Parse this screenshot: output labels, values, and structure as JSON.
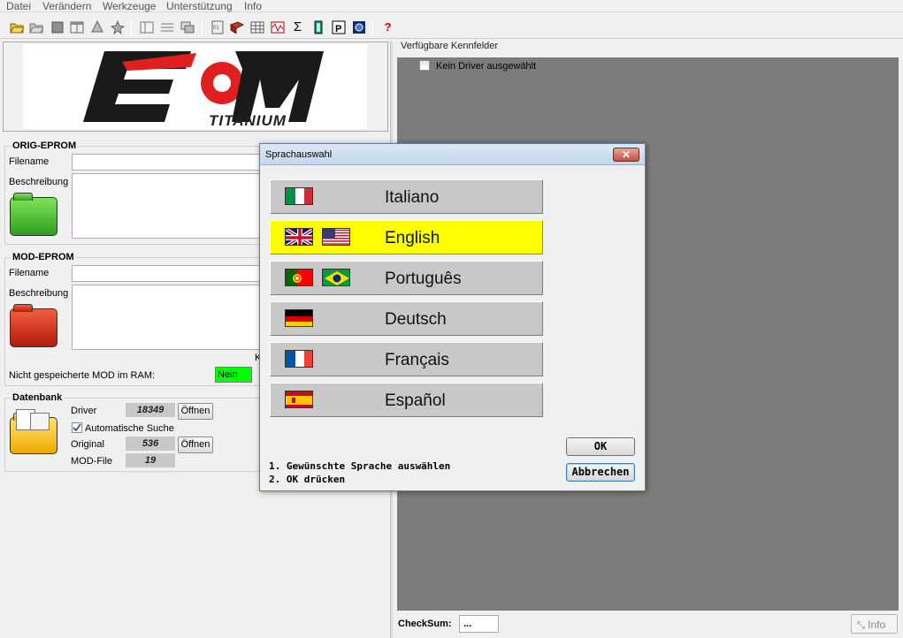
{
  "menu": [
    "Datei",
    "Verändern",
    "Werkzeuge",
    "Unterstützung",
    "Info"
  ],
  "toolbar_icons": [
    "open-folder-icon",
    "open-folder-2-icon",
    "save-icon",
    "window-icon",
    "tree-icon",
    "star-icon",
    "panel-icon",
    "grid-icon",
    "windows-icon",
    "binary-icon",
    "book-icon",
    "table-icon",
    "noise-icon",
    "sigma-icon",
    "battery-icon",
    "p-icon",
    "globe-icon",
    "help-icon"
  ],
  "logo": {
    "text_main": "ECM",
    "text_sub": "TITANIUM"
  },
  "orig": {
    "title": "ORIG-EPROM",
    "filename_label": "Filename",
    "desc_label": "Beschreibung"
  },
  "mod": {
    "title": "MOD-EPROM",
    "filename_label": "Filename",
    "desc_label": "Beschreibung",
    "unsaved_label": "Nicht gespeicherte MOD im RAM:",
    "unsaved_value": "Nein",
    "k_fragment": "K"
  },
  "db": {
    "title": "Datenbank",
    "driver_label": "Driver",
    "driver_value": "18349",
    "driver_open": "Öffnen",
    "auto_label": "Automatische Suche",
    "original_label": "Original",
    "original_value": "536",
    "original_open": "Öffnen",
    "modfile_label": "MOD-File",
    "modfile_value": "19"
  },
  "right": {
    "title": "Verfügbare Kennfelder",
    "no_driver": "Kein Driver ausgewählt"
  },
  "bottom": {
    "checksum_label": "CheckSum:",
    "checksum_value": "...",
    "info_button": "Info"
  },
  "dialog": {
    "title": "Sprachauswahl",
    "close": "✕",
    "languages": [
      {
        "label": "Italiano",
        "flags": [
          "it"
        ],
        "selected": false
      },
      {
        "label": "English",
        "flags": [
          "uk",
          "us"
        ],
        "selected": true
      },
      {
        "label": "Português",
        "flags": [
          "pt",
          "br"
        ],
        "selected": false
      },
      {
        "label": "Deutsch",
        "flags": [
          "de"
        ],
        "selected": false
      },
      {
        "label": "Français",
        "flags": [
          "fr"
        ],
        "selected": false
      },
      {
        "label": "Español",
        "flags": [
          "es"
        ],
        "selected": false
      }
    ],
    "ok": "OK",
    "cancel": "Abbrechen",
    "instruction_1": "1. Gewünschte Sprache auswählen",
    "instruction_2": "2. OK drücken"
  },
  "colors": {
    "selected_language": "#ffff00",
    "ram_status": "#00ff00",
    "logo_red": "#e02020",
    "workspace": "#7c7c7c"
  }
}
